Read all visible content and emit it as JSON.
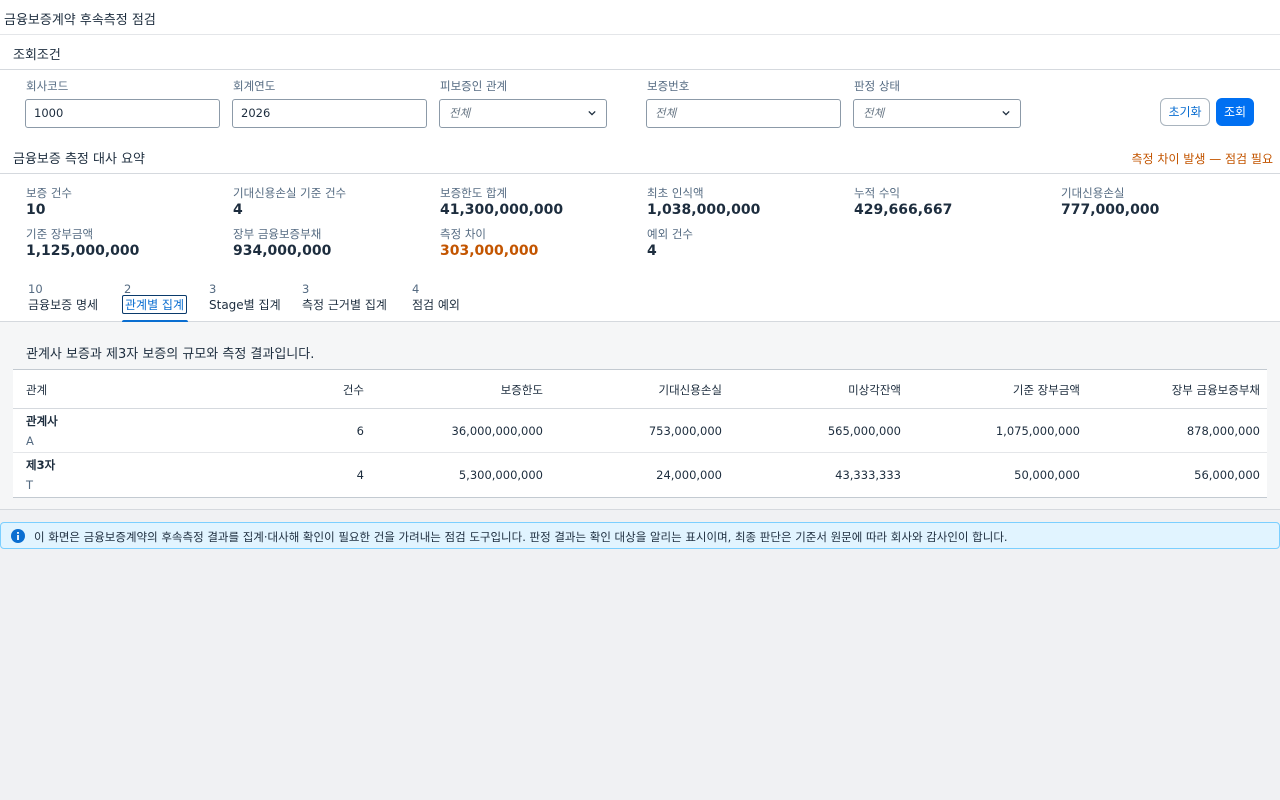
{
  "app": {
    "title": "금융보증계약 후속측정 점검"
  },
  "filters": {
    "title": "조회조건",
    "company_code": {
      "label": "회사코드",
      "value": "1000"
    },
    "fiscal_year": {
      "label": "회계연도",
      "value": "2026"
    },
    "relationship": {
      "label": "피보증인 관계",
      "value": "전체"
    },
    "guarantee_no": {
      "label": "보증번호",
      "placeholder": "전체"
    },
    "judgement": {
      "label": "판정 상태",
      "value": "전체"
    },
    "reset_label": "초기화",
    "search_label": "조회"
  },
  "summary": {
    "title": "금융보증 측정 대사 요약",
    "alert": "측정 차이 발생 — 점검 필요",
    "kpis": [
      {
        "label": "보증 건수",
        "value": "10"
      },
      {
        "label": "기대신용손실 기준 건수",
        "value": "4"
      },
      {
        "label": "보증한도 합계",
        "value": "41,300,000,000"
      },
      {
        "label": "최초 인식액",
        "value": "1,038,000,000"
      },
      {
        "label": "누적 수익",
        "value": "429,666,667"
      },
      {
        "label": "기대신용손실",
        "value": "777,000,000"
      },
      {
        "label": "기준 장부금액",
        "value": "1,125,000,000"
      },
      {
        "label": "장부 금융보증부채",
        "value": "934,000,000"
      },
      {
        "label": "측정 차이",
        "value": "303,000,000"
      },
      {
        "label": "예외 건수",
        "value": "4"
      }
    ]
  },
  "tabs": [
    {
      "count": "10",
      "label": "금융보증 명세"
    },
    {
      "count": "2",
      "label": "관계별 집계"
    },
    {
      "count": "3",
      "label": "Stage별 집계"
    },
    {
      "count": "3",
      "label": "측정 근거별 집계"
    },
    {
      "count": "4",
      "label": "점검 예외"
    }
  ],
  "active_tab_index": 1,
  "section": {
    "description": "관계사 보증과 제3자 보증의 규모와 측정 결과입니다."
  },
  "table": {
    "columns": [
      "관계",
      "건수",
      "보증한도",
      "기대신용손실",
      "미상각잔액",
      "기준 장부금액",
      "장부 금융보증부채"
    ],
    "rows": [
      {
        "name": "관계사",
        "code": "A",
        "count": "6",
        "limit": "36,000,000,000",
        "ecl": "753,000,000",
        "unamortized": "565,000,000",
        "base": "1,075,000,000",
        "book": "878,000,000"
      },
      {
        "name": "제3자",
        "code": "T",
        "count": "4",
        "limit": "5,300,000,000",
        "ecl": "24,000,000",
        "unamortized": "43,333,333",
        "base": "50,000,000",
        "book": "56,000,000"
      }
    ]
  },
  "info": {
    "text": "이 화면은 금융보증계약의 후속측정 결과를 집계·대사해 확인이 필요한 건을 가려내는 점검 도구입니다. 판정 결과는 확인 대상을 알리는 표시이며, 최종 판단은 기준서 원문에 따라 회사와 감사인이 합니다."
  },
  "colors": {
    "accent": "#0070f2",
    "warning": "#c35500",
    "info_bg": "#e1f4ff"
  },
  "icons": {
    "info": "info-icon",
    "chevron": "chevron-down-icon"
  }
}
